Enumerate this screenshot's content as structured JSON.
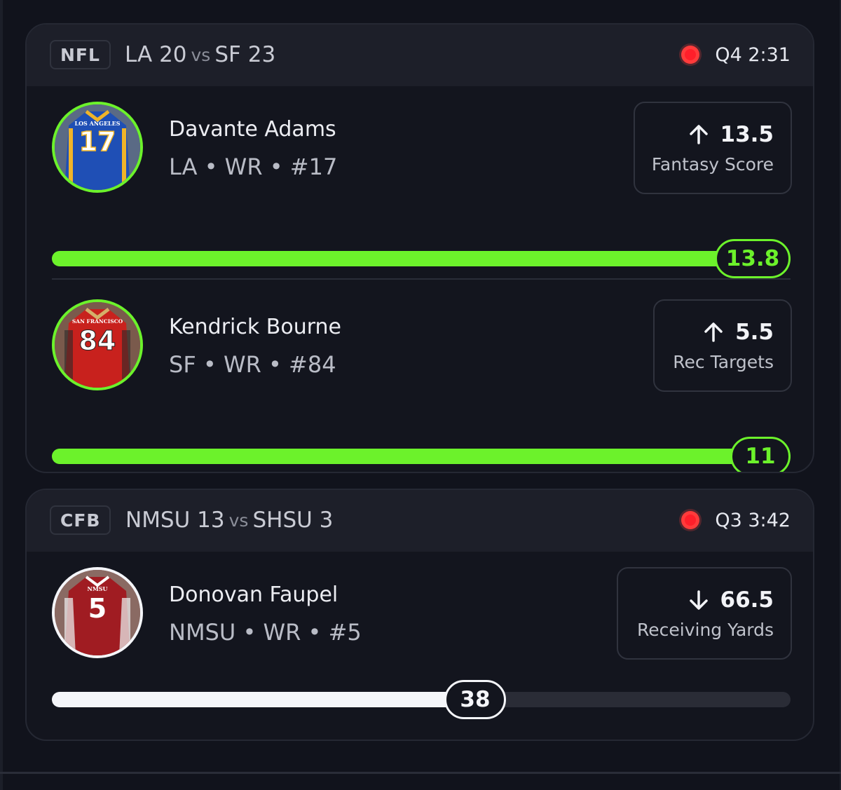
{
  "games": [
    {
      "league": "NFL",
      "team_a": "LA",
      "score_a": "20",
      "vs": "vs",
      "team_b": "SF",
      "score_b": "23",
      "clock": "Q4 2:31",
      "players": [
        {
          "name": "Davante Adams",
          "meta": "LA • WR • #17",
          "jersey_city": "LOS ANGELES",
          "jersey_number": "17",
          "jersey_color": "#1f4fb5",
          "direction": "up",
          "line": "13.5",
          "stat": "Fantasy Score",
          "current": "13.8",
          "progress": 1.0,
          "accent": "#6cf22b"
        },
        {
          "name": "Kendrick Bourne",
          "meta": "SF • WR • #84",
          "jersey_city": "SAN FRANCISCO",
          "jersey_number": "84",
          "jersey_color": "#c8211d",
          "direction": "up",
          "line": "5.5",
          "stat": "Rec Targets",
          "current": "11",
          "progress": 1.0,
          "accent": "#6cf22b"
        }
      ]
    },
    {
      "league": "CFB",
      "team_a": "NMSU",
      "score_a": "13",
      "vs": "vs",
      "team_b": "SHSU",
      "score_b": "3",
      "clock": "Q3 3:42",
      "players": [
        {
          "name": "Donovan Faupel",
          "meta": "NMSU • WR • #5",
          "jersey_city": "NMSU",
          "jersey_number": "5",
          "jersey_color": "#a01c22",
          "direction": "down",
          "line": "66.5",
          "stat": "Receiving Yards",
          "current": "38",
          "progress": 0.57,
          "accent": "#f4f5f9"
        }
      ]
    }
  ]
}
